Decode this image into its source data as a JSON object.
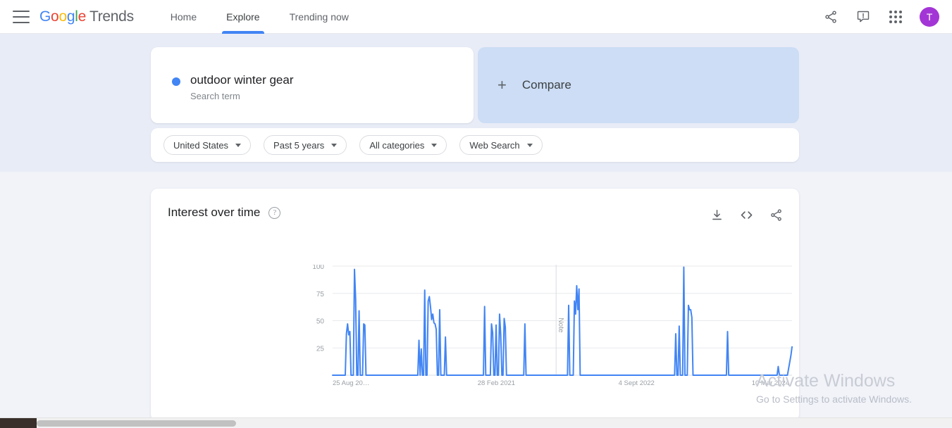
{
  "app": {
    "brand_google": [
      "G",
      "o",
      "o",
      "g",
      "l",
      "e"
    ],
    "brand_suffix": "Trends"
  },
  "topbar": {
    "menu_icon": "hamburger-icon",
    "nav": [
      {
        "label": "Home",
        "active": false
      },
      {
        "label": "Explore",
        "active": true
      },
      {
        "label": "Trending now",
        "active": false
      }
    ],
    "share_icon": "share-icon",
    "feedback_icon": "feedback-icon",
    "apps_icon": "apps-grid-icon",
    "avatar_initial": "T",
    "avatar_color": "#a335d6"
  },
  "search_term": {
    "term": "outdoor winter gear",
    "type_label": "Search term",
    "dot_color": "#4285F4"
  },
  "compare": {
    "plus": "+",
    "label": "Compare",
    "bg_color": "#ccddf5"
  },
  "filters": [
    {
      "label": "United States"
    },
    {
      "label": "Past 5 years"
    },
    {
      "label": "All categories"
    },
    {
      "label": "Web Search"
    }
  ],
  "chart_card": {
    "title": "Interest over time",
    "help_glyph": "?",
    "actions": [
      {
        "name": "download-icon"
      },
      {
        "name": "embed-icon"
      },
      {
        "name": "share-icon"
      }
    ]
  },
  "watermark": {
    "title": "Activate Windows",
    "subtitle": "Go to Settings to activate Windows."
  },
  "chart_data": {
    "type": "line",
    "title": "Interest over time",
    "xlabel": "",
    "ylabel": "",
    "ylim": [
      0,
      100
    ],
    "grid": true,
    "legend": false,
    "line_color": "#4285F4",
    "series_name": "outdoor winter gear",
    "ytick_labels": [
      "100",
      "75",
      "50",
      "25"
    ],
    "ytick_values": [
      100,
      75,
      50,
      25
    ],
    "xtick_labels": [
      "25 Aug 20…",
      "28 Feb 2021",
      "4 Sept 2022",
      "10 Mar 2024"
    ],
    "xtick_positions": [
      0,
      0.3155,
      0.6221,
      0.9121
    ],
    "annotation": {
      "label": "Note",
      "position": 0.4865
    },
    "values": [
      0,
      0,
      0,
      0,
      0,
      0,
      0,
      0,
      0,
      0,
      0,
      0,
      38,
      47,
      37,
      40,
      0,
      0,
      0,
      97,
      70,
      0,
      0,
      59,
      0,
      0,
      0,
      47,
      46,
      0,
      0,
      0,
      0,
      0,
      0,
      0,
      0,
      0,
      0,
      0,
      0,
      0,
      0,
      0,
      0,
      0,
      0,
      0,
      0,
      0,
      0,
      0,
      0,
      0,
      0,
      0,
      0,
      0,
      0,
      0,
      0,
      0,
      0,
      0,
      0,
      0,
      0,
      0,
      0,
      0,
      0,
      0,
      0,
      0,
      0,
      32,
      0,
      24,
      0,
      0,
      78,
      0,
      0,
      68,
      72,
      63,
      51,
      56,
      48,
      47,
      42,
      0,
      0,
      60,
      0,
      0,
      0,
      0,
      35,
      0,
      0,
      0,
      0,
      0,
      0,
      0,
      0,
      0,
      0,
      0,
      0,
      0,
      0,
      0,
      0,
      0,
      0,
      0,
      0,
      0,
      0,
      0,
      0,
      0,
      0,
      0,
      0,
      0,
      0,
      0,
      0,
      0,
      63,
      0,
      0,
      0,
      0,
      0,
      47,
      39,
      0,
      0,
      46,
      0,
      0,
      56,
      37,
      0,
      0,
      52,
      44,
      0,
      0,
      0,
      0,
      0,
      0,
      0,
      0,
      0,
      0,
      0,
      0,
      0,
      0,
      0,
      0,
      47,
      0,
      0,
      0,
      0,
      0,
      0,
      0,
      0,
      0,
      0,
      0,
      0,
      0,
      0,
      0,
      0,
      0,
      0,
      0,
      0,
      0,
      0,
      0,
      0,
      0,
      0,
      0,
      0,
      0,
      0,
      0,
      0,
      0,
      0,
      0,
      0,
      0,
      64,
      0,
      0,
      0,
      0,
      68,
      56,
      82,
      60,
      79,
      0,
      0,
      0,
      0,
      0,
      0,
      0,
      0,
      0,
      0,
      0,
      0,
      0,
      0,
      0,
      0,
      0,
      0,
      0,
      0,
      0,
      0,
      0,
      0,
      0,
      0,
      0,
      0,
      0,
      0,
      0,
      0,
      0,
      0,
      0,
      0,
      0,
      0,
      0,
      0,
      0,
      0,
      0,
      0,
      0,
      0,
      0,
      0,
      0,
      0,
      0,
      0,
      0,
      0,
      0,
      0,
      0,
      0,
      0,
      0,
      0,
      0,
      0,
      0,
      0,
      0,
      0,
      0,
      0,
      0,
      0,
      0,
      0,
      0,
      0,
      0,
      0,
      0,
      0,
      0,
      0,
      0,
      0,
      38,
      0,
      0,
      45,
      0,
      0,
      0,
      99,
      0,
      0,
      0,
      64,
      60,
      60,
      53,
      0,
      0,
      0,
      0,
      0,
      0,
      0,
      0,
      0,
      0,
      0,
      0,
      0,
      0,
      0,
      0,
      0,
      0,
      0,
      0,
      0,
      0,
      0,
      0,
      0,
      0,
      0,
      0,
      0,
      0,
      40,
      0,
      0,
      0,
      0,
      0,
      0,
      0,
      0,
      0,
      0,
      0,
      0,
      0,
      0,
      0,
      0,
      0,
      0,
      0,
      0,
      0,
      0,
      0,
      0,
      0,
      0,
      0,
      0,
      0,
      0,
      0,
      0,
      0,
      0,
      0,
      0,
      0,
      0,
      0,
      0,
      0,
      0,
      0,
      8,
      0,
      0,
      0,
      0,
      0,
      0,
      0,
      0,
      6,
      12,
      18,
      26
    ]
  }
}
